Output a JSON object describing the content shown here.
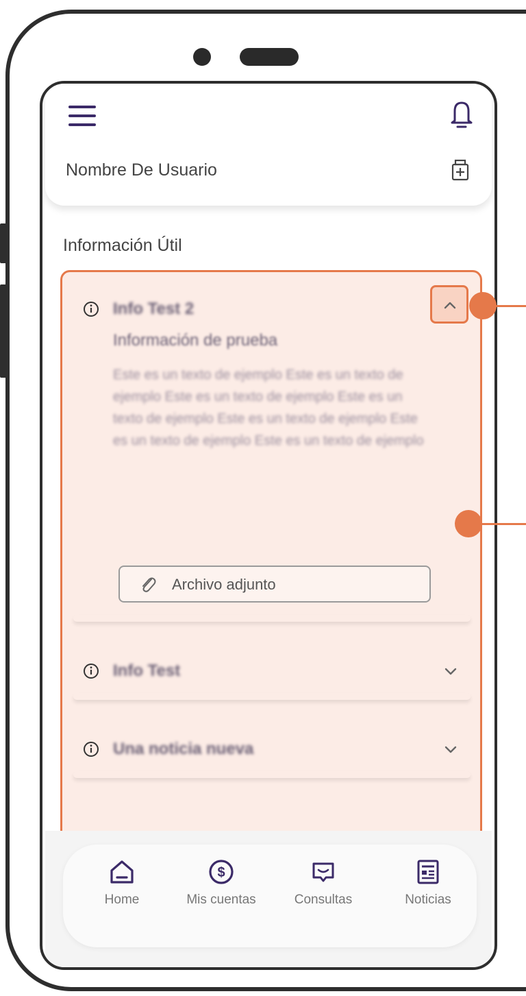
{
  "header": {
    "username": "Nombre De Usuario",
    "menu_icon": "hamburger-menu-icon",
    "bell_icon": "bell-icon",
    "medical_icon": "medicine-box-icon"
  },
  "section": {
    "title": "Información Útil"
  },
  "accordion": {
    "items": [
      {
        "title": "Info Test 2",
        "subtitle": "Información de prueba",
        "body": "Este es un texto de ejemplo Este es un texto de ejemplo Este es un texto de ejemplo Este es un texto de ejemplo Este es un texto de ejemplo Este es un texto de ejemplo Este es un texto de ejemplo",
        "attachment_label": "Archivo adjunto",
        "expanded": true
      },
      {
        "title": "Info Test",
        "expanded": false
      },
      {
        "title": "Una noticia nueva",
        "expanded": false
      }
    ]
  },
  "nav": {
    "items": [
      {
        "label": "Home",
        "icon": "home-icon"
      },
      {
        "label": "Mis cuentas",
        "icon": "dollar-circle-icon"
      },
      {
        "label": "Consultas",
        "icon": "chat-icon"
      },
      {
        "label": "Noticias",
        "icon": "newspaper-icon"
      }
    ]
  },
  "colors": {
    "accent": "#e5794a",
    "highlight_bg": "#fcece6",
    "icon_primary": "#3b2a68",
    "frame": "#2e2e2e"
  }
}
